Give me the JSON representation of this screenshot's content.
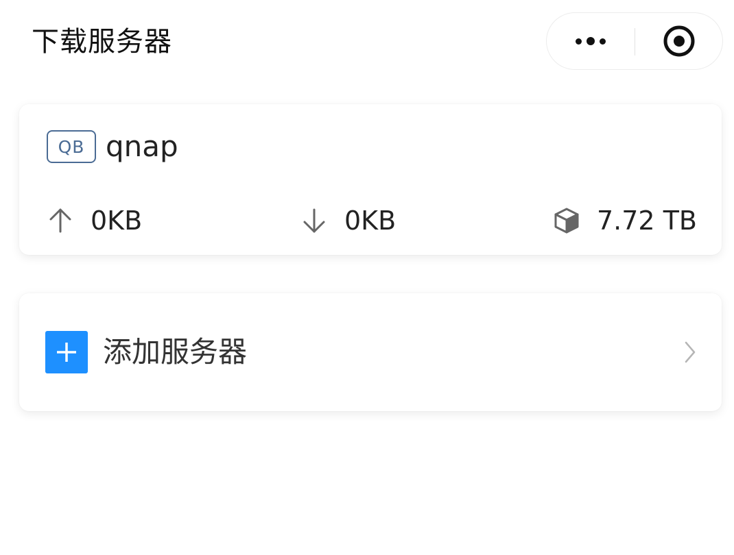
{
  "header": {
    "title": "下载服务器",
    "more_icon": "more-dots-icon",
    "close_icon": "target-circle-icon"
  },
  "server": {
    "badge": "QB",
    "name": "qnap",
    "upload": {
      "icon": "arrow-up-icon",
      "value": "0KB"
    },
    "download": {
      "icon": "arrow-down-icon",
      "value": "0KB"
    },
    "storage": {
      "icon": "cube-icon",
      "value": "7.72 TB"
    }
  },
  "add_server": {
    "label": "添加服务器",
    "icon": "plus-icon",
    "chevron_icon": "chevron-right-icon"
  },
  "colors": {
    "accent": "#1e90ff",
    "badge": "#4a6b94",
    "icon_gray": "#8a8a8a"
  }
}
